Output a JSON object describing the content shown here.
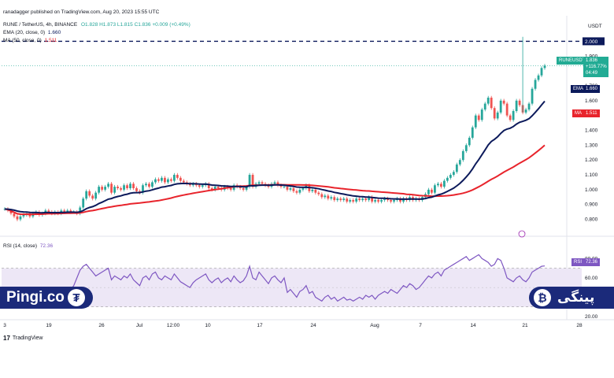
{
  "header": {
    "author": "ranadagger published on TradingView.com, Aug 20, 2023 15:55 UTC",
    "symbol_line": "RUNE / TetherUS, 4h, BINANCE",
    "ohlc": "O1.828 H1.873 L1.815 C1.836 +0.009 (+0.49%)",
    "ema_label": "EMA (20, close, 0)",
    "ema_value": "1.660",
    "ma_label": "MA (50, close, 0)",
    "ma_value": "1.511",
    "rsi_label": "RSI (14, close)",
    "rsi_value": "72.36"
  },
  "price_axis": {
    "currency": "USDT",
    "ticks": [
      "2.000",
      "1.900",
      "1.800",
      "1.700",
      "1.600",
      "1.500",
      "1.400",
      "1.300",
      "1.200",
      "1.100",
      "1.000",
      "0.900",
      "0.800"
    ]
  },
  "rsi_axis": {
    "ticks": [
      "80.00",
      "60.00",
      "40.00",
      "20.00"
    ]
  },
  "price_tags": {
    "symbol": "RUNEUSDT",
    "last": "1.836",
    "change": "+116.77%",
    "countdown": "04:49",
    "ema_tag": "EMA",
    "ema_val": "1.660",
    "ma_tag": "MA",
    "ma_val": "1.511",
    "rsi_tag": "RSI",
    "rsi_val": "72.36"
  },
  "x_axis": {
    "labels": [
      "3",
      "19",
      "26",
      "Jul",
      "12:00",
      "10",
      "17",
      "24",
      "Aug",
      "7",
      "14",
      "21",
      "28"
    ]
  },
  "footer": {
    "tv": "TradingView"
  },
  "watermarks": {
    "left": "Pingi.co",
    "right": "پینگی"
  },
  "colors": {
    "up": "#26a69a",
    "down": "#ef5350",
    "ema": "#0c1a5b",
    "ma": "#e8242c",
    "rsi": "#7e57c2",
    "band": "#ede7f6",
    "last": "#22ab94"
  },
  "chart_data": {
    "type": "candlestick",
    "timeframe": "4h",
    "ylim": [
      0.75,
      2.05
    ],
    "resistance": 2.0,
    "close": [
      0.87,
      0.86,
      0.84,
      0.82,
      0.8,
      0.82,
      0.83,
      0.84,
      0.82,
      0.84,
      0.85,
      0.83,
      0.84,
      0.86,
      0.85,
      0.84,
      0.85,
      0.84,
      0.86,
      0.85,
      0.86,
      0.85,
      0.85,
      0.84,
      0.88,
      0.94,
      0.99,
      0.96,
      0.94,
      0.98,
      1.02,
      1.0,
      1.02,
      1.04,
      0.98,
      1.02,
      1.01,
      1.0,
      1.03,
      1.01,
      1.04,
      1.01,
      0.99,
      0.98,
      1.03,
      1.04,
      1.02,
      1.05,
      1.07,
      1.06,
      1.08,
      1.05,
      1.07,
      1.06,
      1.1,
      1.08,
      1.06,
      1.05,
      1.04,
      1.03,
      1.04,
      1.03,
      1.02,
      1.03,
      1.04,
      1.01,
      1.0,
      1.02,
      1.01,
      1.0,
      1.02,
      1.01,
      1.0,
      1.03,
      1.02,
      1.01,
      1.0,
      1.02,
      1.1,
      1.02,
      1.04,
      1.05,
      1.04,
      1.03,
      1.02,
      1.04,
      1.05,
      1.03,
      1.02,
      1.02,
      1.0,
      1.01,
      0.99,
      0.98,
      1.0,
      1.01,
      1.03,
      0.99,
      1.0,
      0.98,
      0.97,
      0.95,
      0.96,
      0.94,
      0.95,
      0.93,
      0.94,
      0.93,
      0.94,
      0.92,
      0.93,
      0.92,
      0.94,
      0.93,
      0.94,
      0.93,
      0.95,
      0.92,
      0.93,
      0.92,
      0.93,
      0.94,
      0.93,
      0.92,
      0.93,
      0.94,
      0.92,
      0.94,
      0.93,
      0.95,
      0.93,
      0.94,
      0.93,
      0.95,
      0.97,
      1.0,
      0.98,
      1.03,
      1.04,
      1.02,
      1.06,
      1.08,
      1.1,
      1.12,
      1.17,
      1.2,
      1.26,
      1.3,
      1.35,
      1.42,
      1.5,
      1.47,
      1.54,
      1.58,
      1.62,
      1.55,
      1.48,
      1.52,
      1.6,
      1.58,
      1.5,
      1.47,
      1.53,
      1.6,
      1.57,
      1.52,
      1.54,
      1.58,
      1.68,
      1.74,
      1.77,
      1.82,
      1.836
    ],
    "ema20_end": 1.66,
    "ma50_end": 1.511,
    "rsi": [
      47,
      45,
      43,
      44,
      42,
      40,
      42,
      43,
      46,
      44,
      45,
      44,
      47,
      46,
      45,
      44,
      46,
      45,
      44,
      47,
      46,
      48,
      52,
      60,
      68,
      72,
      74,
      70,
      66,
      62,
      64,
      66,
      68,
      70,
      58,
      62,
      60,
      58,
      62,
      60,
      64,
      58,
      55,
      52,
      60,
      62,
      58,
      64,
      66,
      60,
      58,
      62,
      60,
      58,
      64,
      60,
      56,
      54,
      52,
      50,
      55,
      58,
      60,
      62,
      64,
      58,
      55,
      58,
      60,
      55,
      58,
      60,
      56,
      62,
      58,
      55,
      57,
      62,
      72,
      60,
      58,
      66,
      62,
      58,
      54,
      60,
      62,
      58,
      55,
      60,
      45,
      48,
      44,
      40,
      46,
      48,
      52,
      44,
      46,
      40,
      38,
      36,
      40,
      42,
      38,
      40,
      36,
      38,
      40,
      37,
      38,
      36,
      38,
      40,
      38,
      42,
      40,
      42,
      38,
      42,
      44,
      46,
      44,
      48,
      46,
      44,
      48,
      52,
      50,
      54,
      52,
      48,
      50,
      54,
      58,
      62,
      60,
      64,
      66,
      62,
      68,
      70,
      72,
      74,
      76,
      78,
      80,
      82,
      78,
      80,
      82,
      84,
      80,
      78,
      76,
      72,
      74,
      80,
      78,
      70,
      60,
      58,
      56,
      60,
      62,
      58,
      56,
      60,
      66,
      68,
      70,
      72,
      72.36
    ],
    "rsi_ylim": [
      20,
      90
    ],
    "series_names": [
      "EMA (20, close, 0)",
      "MA (50, close, 0)",
      "RSI (14, close)"
    ]
  }
}
